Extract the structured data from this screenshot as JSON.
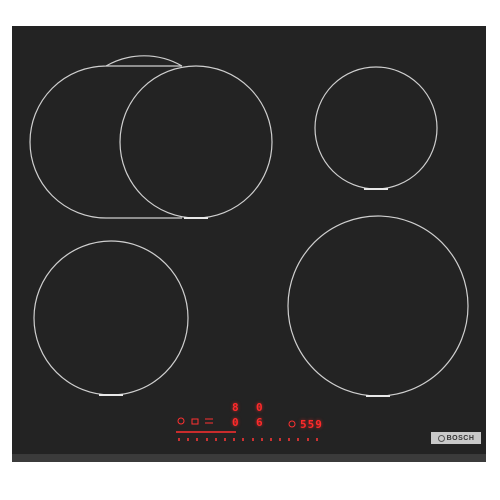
{
  "hob": {
    "corner_left_text": "",
    "corner_right_text": ""
  },
  "brand": {
    "name": "BOSCH"
  },
  "controls": {
    "zone_front_left_level": "8",
    "zone_front_right_level": "0",
    "zone_small_level": "0",
    "zone_big_level": "6",
    "timer_display": "559",
    "lock_icon": "lock-icon",
    "power_icon": "power-icon",
    "colors": {
      "display": "#ff2a2a",
      "glass": "#232323",
      "ring": "#d0d0d0"
    }
  }
}
